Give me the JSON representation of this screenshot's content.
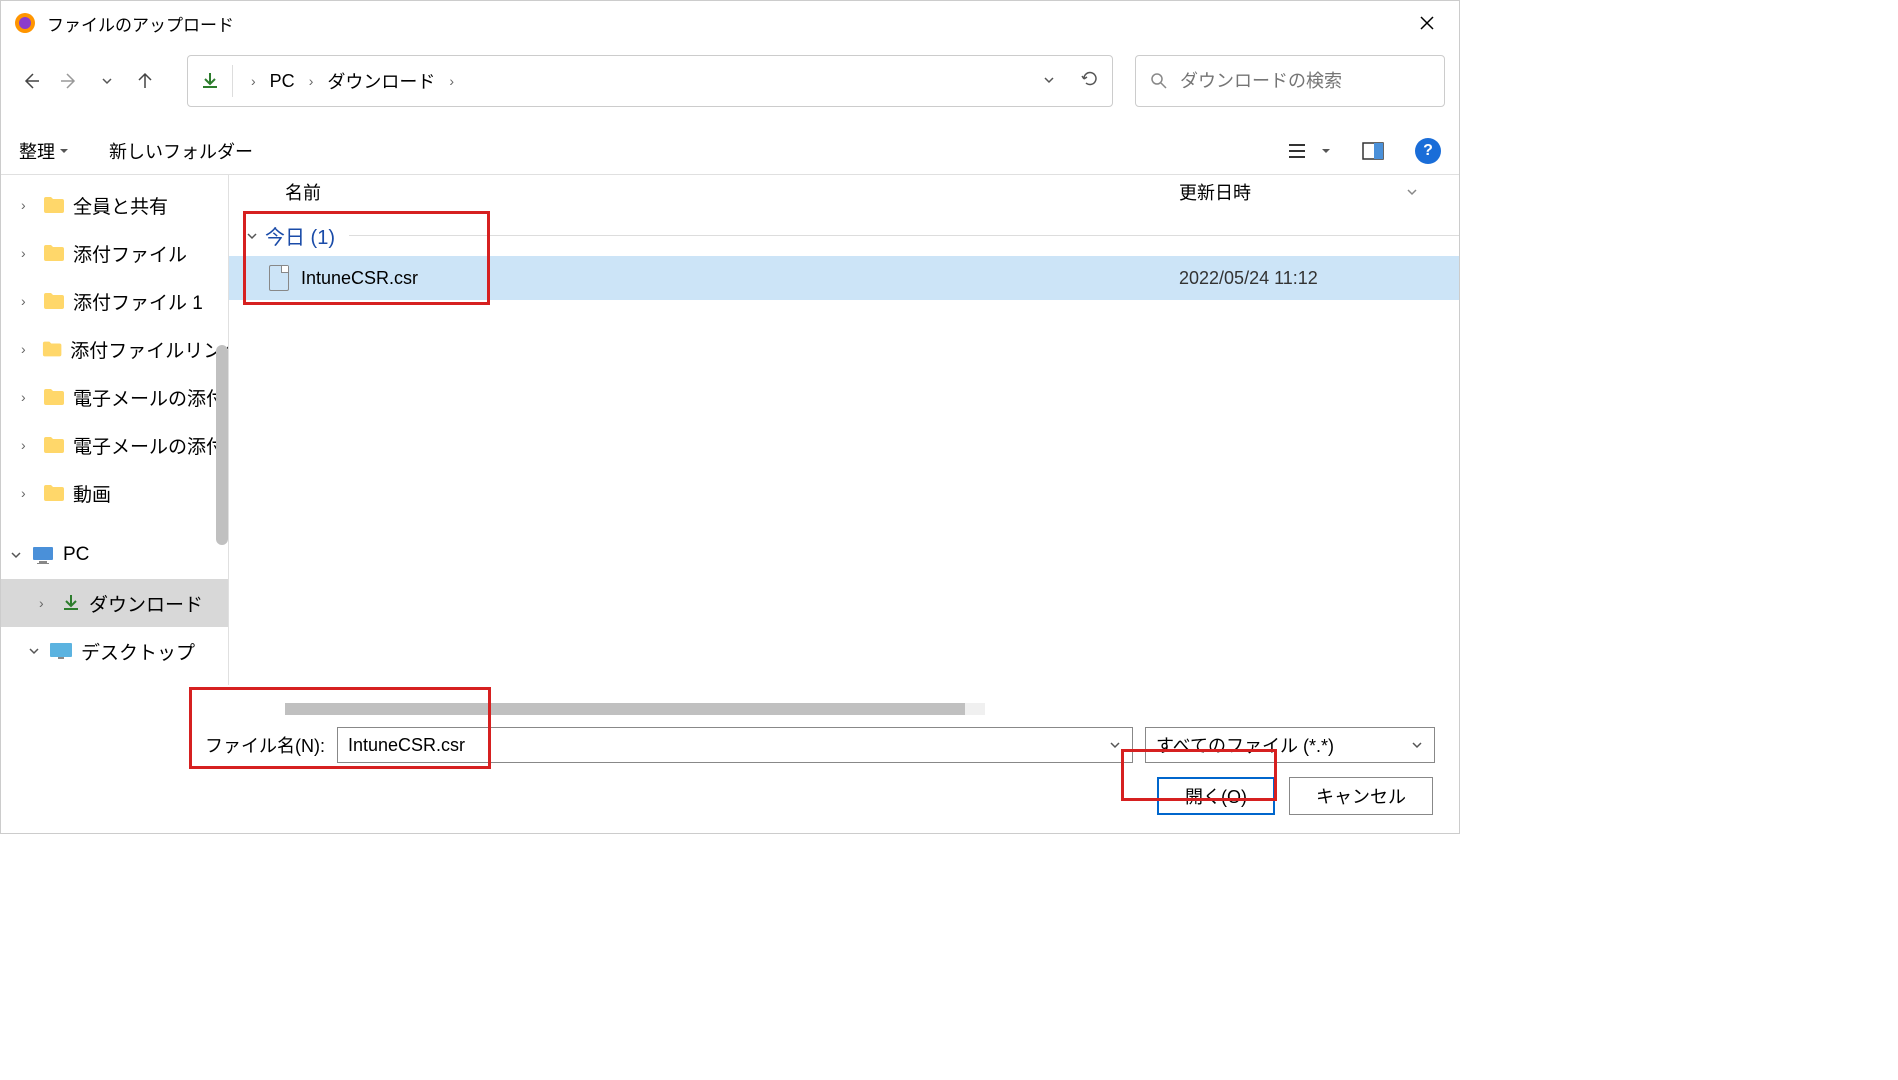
{
  "title": "ファイルのアップロード",
  "breadcrumb": {
    "loc1": "PC",
    "loc2": "ダウンロード"
  },
  "search": {
    "placeholder": "ダウンロードの検索"
  },
  "toolbar": {
    "organize": "整理",
    "newfolder": "新しいフォルダー"
  },
  "sidebar": {
    "items": [
      {
        "label": "全員と共有"
      },
      {
        "label": "添付ファイル"
      },
      {
        "label": "添付ファイル 1"
      },
      {
        "label": "添付ファイルリンク"
      },
      {
        "label": "電子メールの添付"
      },
      {
        "label": "電子メールの添付"
      },
      {
        "label": "動画"
      }
    ],
    "pc": "PC",
    "downloads": "ダウンロード",
    "desktop": "デスクトップ"
  },
  "filelist": {
    "col_name": "名前",
    "col_date": "更新日時",
    "group": "今日 (1)",
    "file_name": "IntuneCSR.csr",
    "file_date": "2022/05/24 11:12"
  },
  "bottom": {
    "filename_label": "ファイル名(N):",
    "filename_value": "IntuneCSR.csr",
    "filetype": "すべてのファイル (*.*)",
    "open_btn": "開く(O)",
    "cancel_btn": "キャンセル"
  }
}
